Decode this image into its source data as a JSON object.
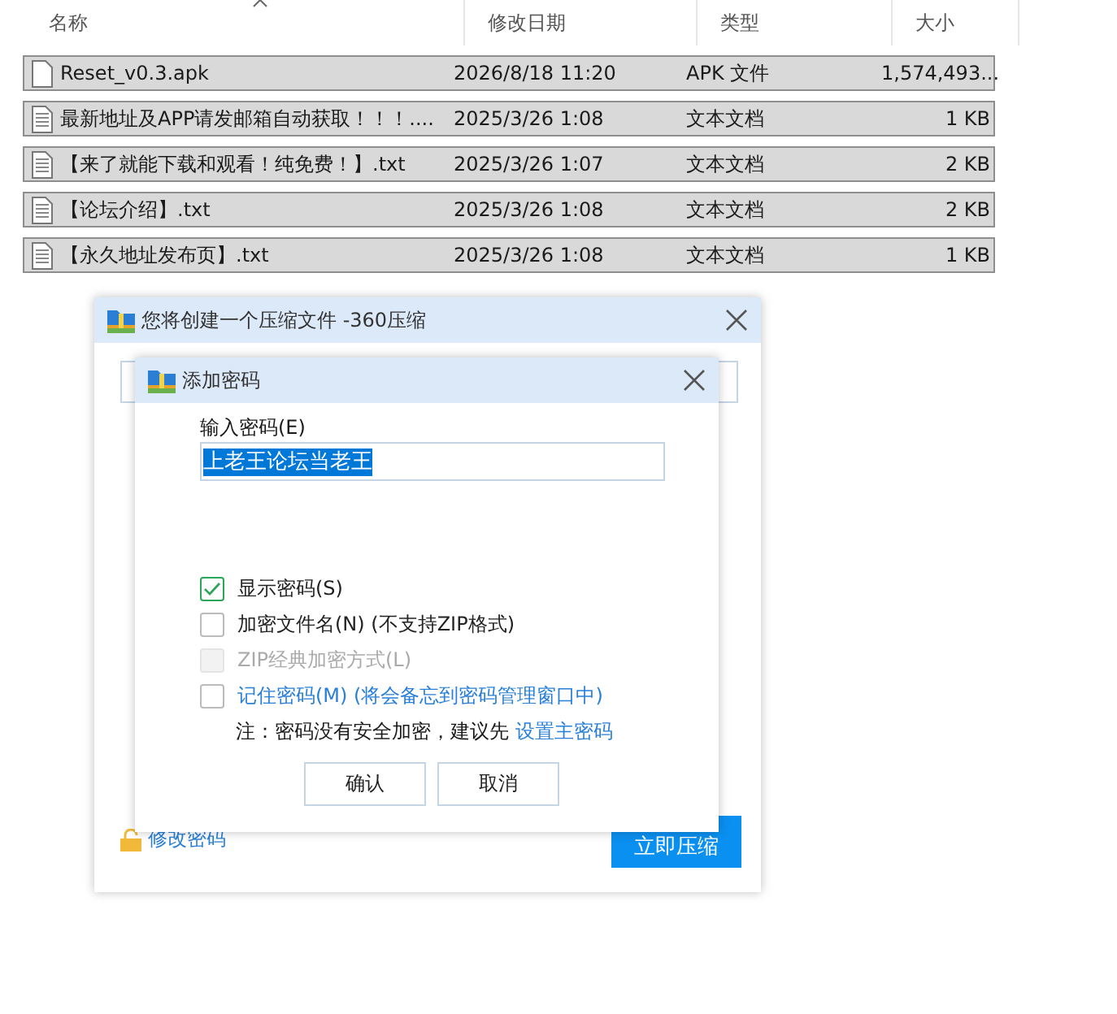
{
  "file_list": {
    "columns": [
      {
        "label": "名称",
        "sorted": true
      },
      {
        "label": "修改日期",
        "sorted": false
      },
      {
        "label": "类型",
        "sorted": false
      },
      {
        "label": "大小",
        "sorted": false
      }
    ],
    "rows": [
      {
        "kind": "apk",
        "name": "Reset_v0.3.apk",
        "date": "2026/8/18 11:20",
        "type": "APK 文件",
        "size": "1,574,493...",
        "selected": true
      },
      {
        "kind": "text",
        "name": "最新地址及APP请发邮箱自动获取！！！....",
        "date": "2025/3/26 1:08",
        "type": "文本文档",
        "size": "1 KB",
        "selected": true
      },
      {
        "kind": "text",
        "name": "【来了就能下载和观看！纯免费！】.txt",
        "date": "2025/3/26 1:07",
        "type": "文本文档",
        "size": "2 KB",
        "selected": true
      },
      {
        "kind": "text",
        "name": "【论坛介绍】.txt",
        "date": "2025/3/26 1:08",
        "type": "文本文档",
        "size": "2 KB",
        "selected": true
      },
      {
        "kind": "text",
        "name": "【永久地址发布页】.txt",
        "date": "2025/3/26 1:08",
        "type": "文本文档",
        "size": "1 KB",
        "selected": true
      }
    ]
  },
  "compress_dialog": {
    "title": "您将创建一个压缩文件 -360压缩",
    "change_password_link": "修改密码",
    "compress_button": "立即压缩"
  },
  "password_dialog": {
    "title": "添加密码",
    "password_label": "输入密码(E)",
    "password_value": "上老王论坛当老王",
    "options": [
      {
        "label": "显示密码(S)",
        "checked": true,
        "disabled": false,
        "link": false
      },
      {
        "label": "加密文件名(N) (不支持ZIP格式)",
        "checked": false,
        "disabled": false,
        "link": false
      },
      {
        "label": "ZIP经典加密方式(L)",
        "checked": false,
        "disabled": true,
        "link": false
      },
      {
        "label": "记住密码(M) (将会备忘到密码管理窗口中)",
        "checked": false,
        "disabled": false,
        "link": true
      }
    ],
    "note": "注：密码没有安全加密，建议先",
    "note_link": "设置主密码",
    "buttons": [
      "确认",
      "取消"
    ]
  }
}
